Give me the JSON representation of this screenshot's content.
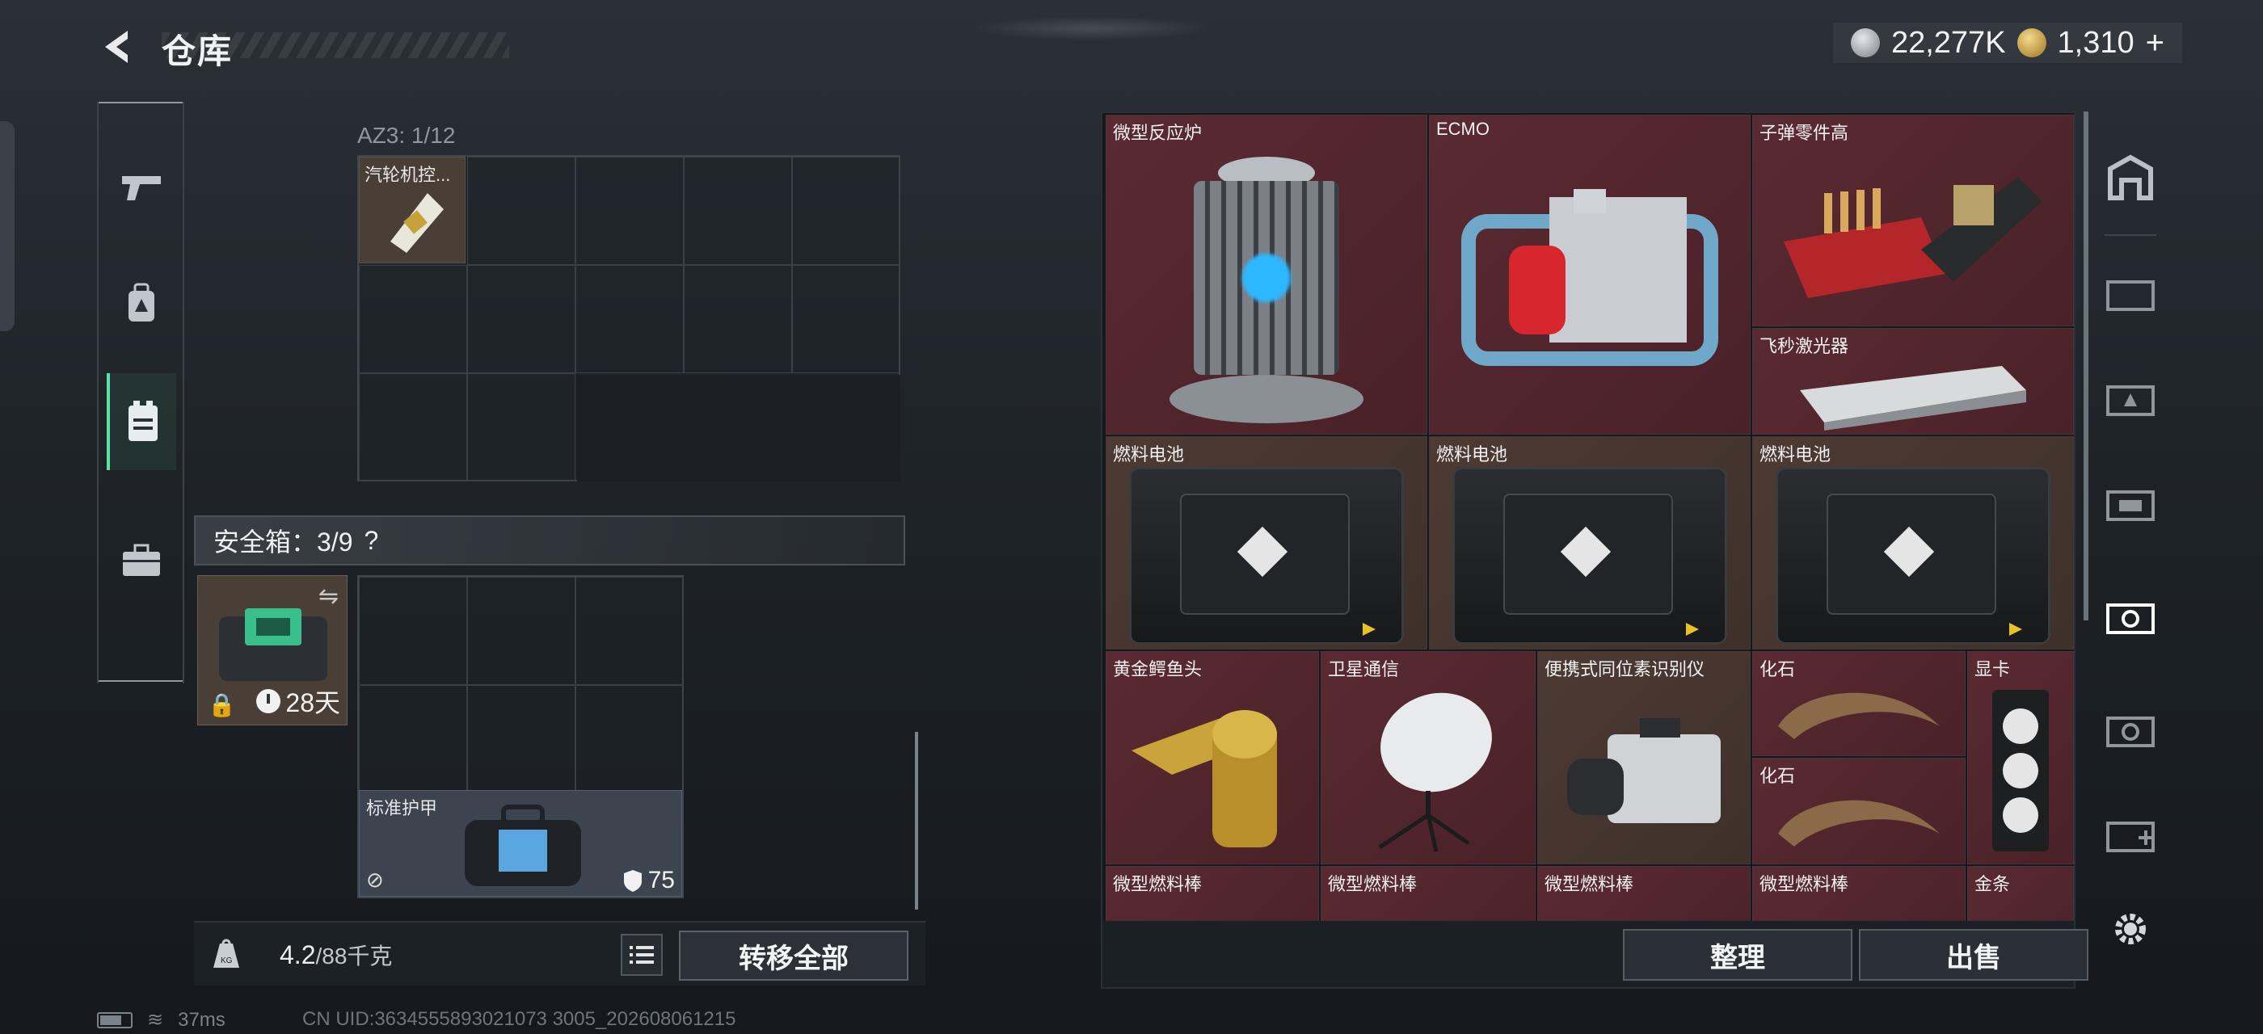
{
  "header": {
    "title": "仓库",
    "currency_silver": "22,277K",
    "currency_gold": "1,310",
    "add_symbol": "+"
  },
  "left_nav": {
    "items": [
      {
        "icon": "pistol-icon"
      },
      {
        "icon": "backpack-icon"
      },
      {
        "icon": "vest-icon",
        "active": true
      },
      {
        "icon": "briefcase-icon"
      }
    ]
  },
  "container": {
    "label": "AZ3: 1/12",
    "item_name": "汽轮机控..."
  },
  "safe_box": {
    "label": "安全箱：3/9",
    "help": "?",
    "days": "28天"
  },
  "armor": {
    "name": "标准护甲",
    "durability": "75"
  },
  "bottom_left": {
    "weight": "4.2",
    "capacity": "/88千克",
    "transfer_all": "转移全部"
  },
  "stash": {
    "items": [
      {
        "label": "微型反应炉",
        "color": "red"
      },
      {
        "label": "ECMO",
        "color": "red"
      },
      {
        "label": "子弹零件高",
        "color": "red"
      },
      {
        "label": "飞秒激光器",
        "color": "red"
      },
      {
        "label": "燃料电池",
        "color": "brown"
      },
      {
        "label": "燃料电池",
        "color": "brown"
      },
      {
        "label": "燃料电池",
        "color": "brown"
      },
      {
        "label": "黄金鳄鱼头",
        "color": "red"
      },
      {
        "label": "卫星通信",
        "color": "red"
      },
      {
        "label": "便携式同位素识别仪",
        "color": "brown"
      },
      {
        "label": "化石",
        "color": "red"
      },
      {
        "label": "化石",
        "color": "red"
      },
      {
        "label": "显卡",
        "color": "red"
      },
      {
        "label": "微型燃料棒",
        "color": "red"
      },
      {
        "label": "微型燃料棒",
        "color": "red"
      },
      {
        "label": "微型燃料棒",
        "color": "red"
      },
      {
        "label": "微型燃料棒",
        "color": "red"
      },
      {
        "label": "金条",
        "color": "red"
      }
    ],
    "sort_button": "整理",
    "sell_button": "出售"
  },
  "status_bar": {
    "ping": "37ms",
    "uid": "CN UID:3634555893021073 3005_202608061215"
  },
  "colors": {
    "accent_green": "#5ee0a8",
    "red_item": "#5a2a32",
    "brown_item": "#4d3b33",
    "armor_bg": "#3c4450"
  }
}
